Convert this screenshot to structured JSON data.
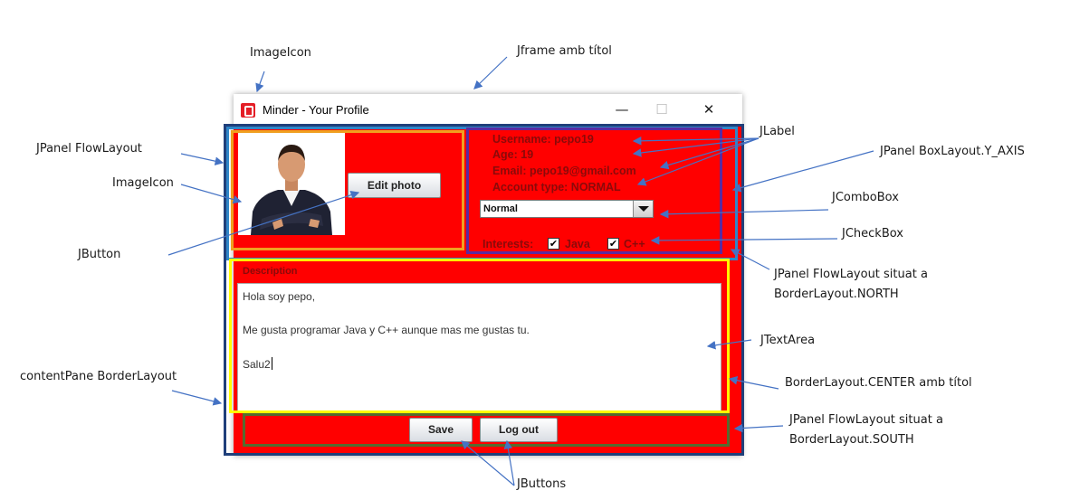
{
  "annotations": {
    "imageicon_top": "ImageIcon",
    "jframe": "Jframe amb títol",
    "jpanel_flowlayout": "JPanel FlowLayout",
    "imageicon_left": "ImageIcon",
    "jbutton": "JButton",
    "contentpane": "contentPane BorderLayout",
    "jlabel": "JLabel",
    "boxlayout": "JPanel BoxLayout.Y_AXIS",
    "jcombobox": "JComboBox",
    "jcheckbox": "JCheckBox",
    "north_line1": "JPanel FlowLayout situat a",
    "north_line2": "BorderLayout.NORTH",
    "jtextarea": "JTextArea",
    "center": "BorderLayout.CENTER amb títol",
    "south_line1": "JPanel FlowLayout situat a",
    "south_line2": "BorderLayout.SOUTH",
    "jbuttons": "JButtons"
  },
  "window": {
    "title": "Minder - Your Profile",
    "minimize": "—",
    "maximize": "☐",
    "close": "✕"
  },
  "profile": {
    "edit_photo": "Edit photo",
    "username": "Username: pepo19",
    "age": "Age: 19",
    "email": "Email: pepo19@gmail.com",
    "account_type": "Account type: NORMAL",
    "combo_value": "Normal",
    "interests_label": "Interests:",
    "interest_1": "Java",
    "interest_2": "C++"
  },
  "description": {
    "title": "Description",
    "line1": "Hola soy pepo,",
    "line2": "Me gusta programar Java y C++ aunque mas me gustas tu.",
    "line3": "Salu2"
  },
  "buttons": {
    "save": "Save",
    "logout": "Log out"
  },
  "colors": {
    "panel_background": "#ff0000",
    "outline_contentpane": "#1f3f7a",
    "outline_flowlayout": "#f0a020",
    "outline_boxlayout": "#5a2aa0",
    "outline_north": "#2f86c8",
    "outline_center": "#ffff00",
    "outline_south": "#556b2f",
    "arrows": "#4472c4"
  }
}
